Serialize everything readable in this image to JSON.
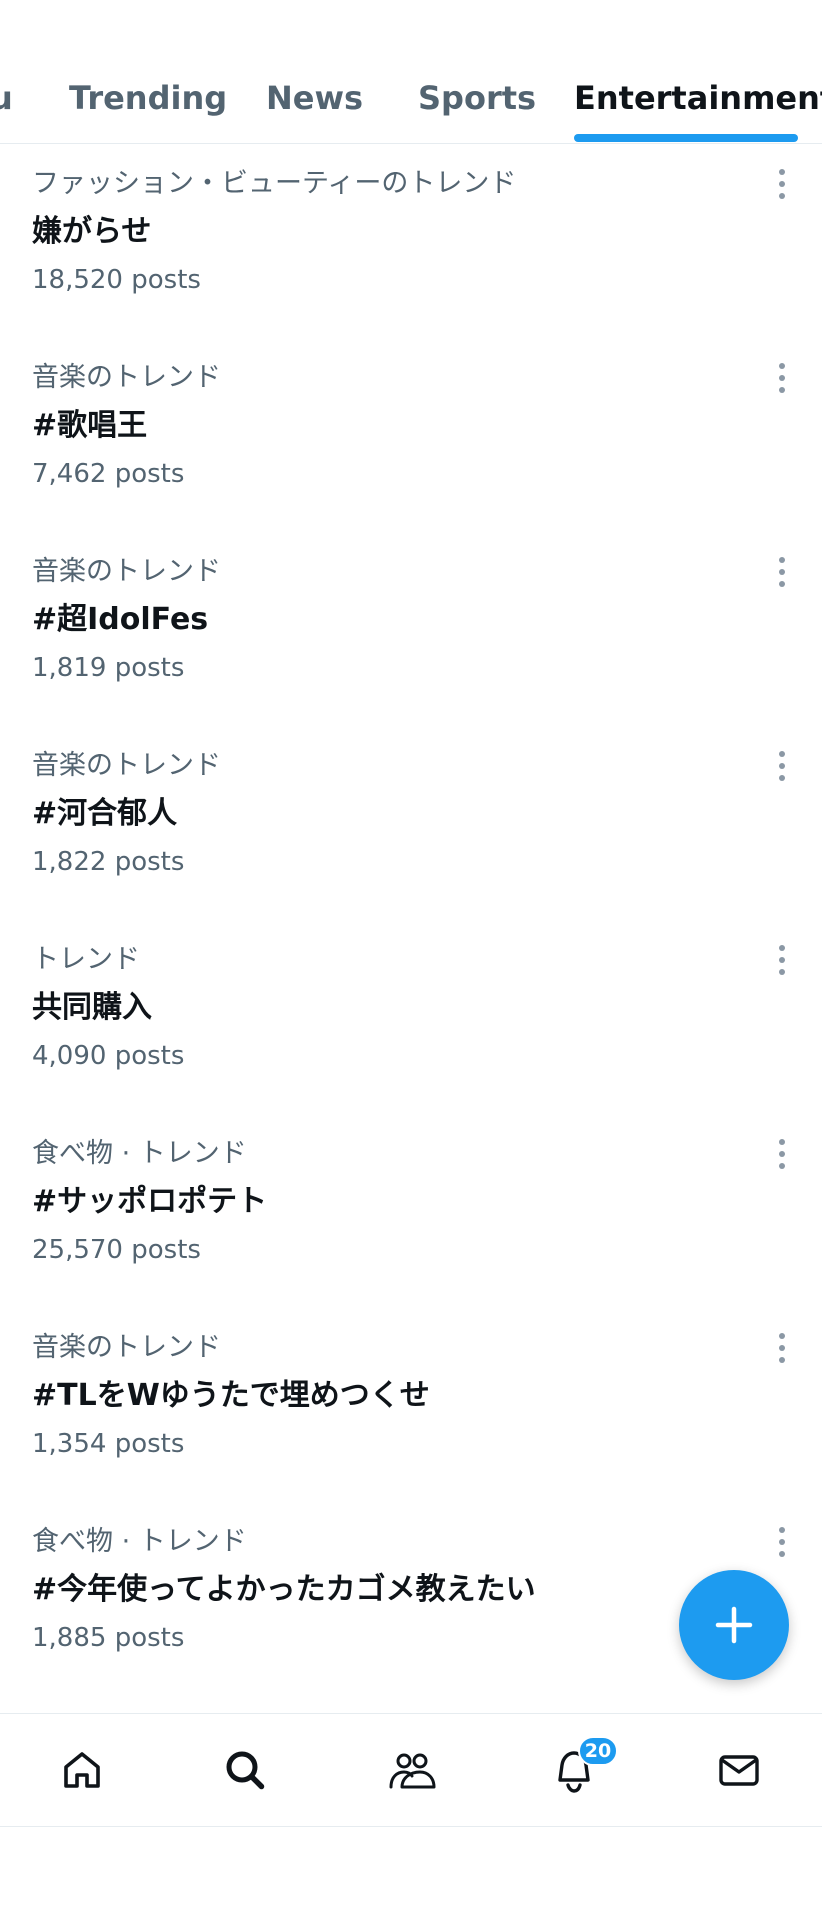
{
  "tabs": [
    {
      "label": "u",
      "active": false
    },
    {
      "label": "Trending",
      "active": false
    },
    {
      "label": "News",
      "active": false
    },
    {
      "label": "Sports",
      "active": false
    },
    {
      "label": "Entertainment",
      "active": true
    }
  ],
  "trends": [
    {
      "category": "ファッション・ビューティーのトレンド",
      "title": "嫌がらせ",
      "posts": "18,520 posts"
    },
    {
      "category": "音楽のトレンド",
      "title": "#歌唱王",
      "posts": "7,462 posts"
    },
    {
      "category": "音楽のトレンド",
      "title": "#超IdolFes",
      "posts": "1,819 posts"
    },
    {
      "category": "音楽のトレンド",
      "title": "#河合郁人",
      "posts": "1,822 posts"
    },
    {
      "category": "トレンド",
      "title": "共同購入",
      "posts": "4,090 posts"
    },
    {
      "category": "食べ物 · トレンド",
      "title": "#サッポロポテト",
      "posts": "25,570 posts"
    },
    {
      "category": "音楽のトレンド",
      "title": "#TLをWゆうたで埋めつくせ",
      "posts": "1,354 posts"
    },
    {
      "category": "食べ物 · トレンド",
      "title": "#今年使ってよかったカゴメ教えたい",
      "posts": "1,885 posts"
    }
  ],
  "fab": {
    "icon": "plus-icon"
  },
  "bottom_nav": {
    "items": [
      {
        "name": "home",
        "icon": "home-icon"
      },
      {
        "name": "search",
        "icon": "search-icon"
      },
      {
        "name": "communities",
        "icon": "people-icon"
      },
      {
        "name": "notifications",
        "icon": "bell-icon"
      },
      {
        "name": "messages",
        "icon": "mail-icon"
      }
    ],
    "notification_badge": "20"
  },
  "colors": {
    "accent": "#1d9bf0",
    "text_primary": "#0f1419",
    "text_secondary": "#536471",
    "divider": "#e6ecf0"
  }
}
